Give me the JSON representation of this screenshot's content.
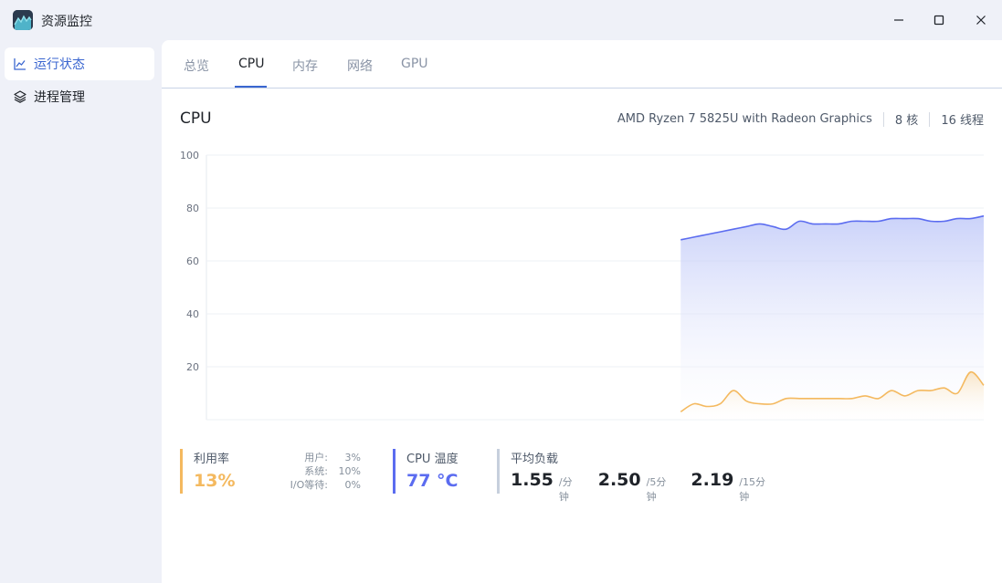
{
  "app": {
    "title": "资源监控"
  },
  "window_controls": {
    "minimize_icon": "minimize-icon",
    "maximize_icon": "maximize-icon",
    "close_icon": "close-icon"
  },
  "sidebar": {
    "items": [
      {
        "label": "运行状态",
        "icon": "line-chart-icon",
        "active": true
      },
      {
        "label": "进程管理",
        "icon": "layers-icon",
        "active": false
      }
    ]
  },
  "tabs": [
    {
      "label": "总览",
      "active": false
    },
    {
      "label": "CPU",
      "active": true
    },
    {
      "label": "内存",
      "active": false
    },
    {
      "label": "网络",
      "active": false
    },
    {
      "label": "GPU",
      "active": false
    }
  ],
  "cpu": {
    "title": "CPU",
    "model": "AMD Ryzen 7 5825U with Radeon Graphics",
    "cores": "8 核",
    "threads": "16 线程"
  },
  "colors": {
    "accent": "#3a66d0",
    "usage": "#f4b95f",
    "temperature": "#5b6cf0",
    "load": "#c7cfdd"
  },
  "chart_data": {
    "type": "area",
    "ylim": [
      0,
      100
    ],
    "yticks": [
      "20",
      "40",
      "60",
      "80",
      "100"
    ],
    "grid": true,
    "legend": "none",
    "x": [
      0,
      1,
      2,
      3,
      4,
      5,
      6,
      7,
      8,
      9,
      10,
      11,
      12,
      13,
      14,
      15,
      16,
      17,
      18,
      19,
      20,
      21,
      22,
      23,
      24,
      25,
      26,
      27,
      28,
      29,
      30,
      31,
      32,
      33,
      34,
      35,
      36,
      37,
      38,
      39,
      40,
      41,
      42,
      43,
      44,
      45,
      46,
      47,
      48,
      49,
      50,
      51,
      52,
      53,
      54,
      55,
      56,
      57,
      58,
      59
    ],
    "series": [
      {
        "color": "#5b6cf0",
        "values": [
          null,
          null,
          null,
          null,
          null,
          null,
          null,
          null,
          null,
          null,
          null,
          null,
          null,
          null,
          null,
          null,
          null,
          null,
          null,
          null,
          null,
          null,
          null,
          null,
          null,
          null,
          null,
          null,
          null,
          null,
          null,
          null,
          null,
          null,
          null,
          null,
          68,
          69,
          70,
          71,
          72,
          73,
          74,
          73,
          72,
          75,
          74,
          74,
          74,
          75,
          75,
          75,
          76,
          76,
          76,
          75,
          75,
          76,
          76,
          77
        ]
      },
      {
        "color": "#f4b95f",
        "values": [
          null,
          null,
          null,
          null,
          null,
          null,
          null,
          null,
          null,
          null,
          null,
          null,
          null,
          null,
          null,
          null,
          null,
          null,
          null,
          null,
          null,
          null,
          null,
          null,
          null,
          null,
          null,
          null,
          null,
          null,
          null,
          null,
          null,
          null,
          null,
          null,
          3,
          6,
          5,
          6,
          11,
          7,
          6,
          6,
          8,
          8,
          8,
          8,
          8,
          8,
          9,
          8,
          11,
          9,
          11,
          11,
          12,
          10,
          18,
          13
        ]
      }
    ]
  },
  "stats": {
    "usage": {
      "label": "利用率",
      "value": "13%",
      "user_label": "用户:",
      "user_value": "3%",
      "system_label": "系统:",
      "system_value": "10%",
      "io_label": "I/O等待:",
      "io_value": "0%"
    },
    "temperature": {
      "label": "CPU 温度",
      "value": "77 °C"
    },
    "load": {
      "label": "平均负载",
      "l1": "1.55",
      "l1_unit": "/分钟",
      "l5": "2.50",
      "l5_unit": "/5分钟",
      "l15": "2.19",
      "l15_unit": "/15分钟"
    }
  }
}
